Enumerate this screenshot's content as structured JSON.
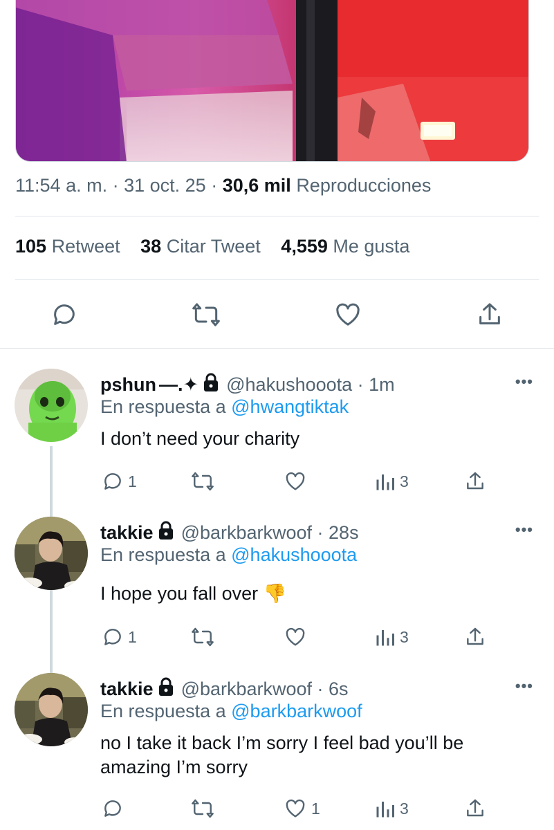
{
  "tweet": {
    "time": "11:54 a. m.",
    "sep1": "·",
    "date": "31 oct. 25",
    "sep2": "·",
    "views_count": "30,6 mil",
    "views_label": "Reproducciones",
    "retweets_count": "105",
    "retweets_label": "Retweet",
    "quotes_count": "38",
    "quotes_label": "Citar Tweet",
    "likes_count": "4,559",
    "likes_label": "Me gusta"
  },
  "replies": [
    {
      "name": "pshun",
      "name_extra": "—.✦",
      "handle_time": "@hakushooota · 1m",
      "reply_prefix": "En respuesta a",
      "reply_to": "@hwangtiktak",
      "text": "I don’t need your charity",
      "reply_count": "1",
      "retweet_count": "",
      "like_count": "",
      "views_count": "3",
      "more": "•••"
    },
    {
      "name": "takkie",
      "name_extra": "",
      "handle_time": "@barkbarkwoof · 28s",
      "reply_prefix": "En respuesta a",
      "reply_to": "@hakushooota",
      "text": "I hope you fall over 👎",
      "reply_count": "1",
      "retweet_count": "",
      "like_count": "",
      "views_count": "3",
      "more": "•••"
    },
    {
      "name": "takkie",
      "name_extra": "",
      "handle_time": "@barkbarkwoof · 6s",
      "reply_prefix": "En respuesta a",
      "reply_to": "@barkbarkwoof",
      "text": "no I take it back I’m sorry I feel bad you’ll be amazing I’m sorry",
      "reply_count": "",
      "retweet_count": "",
      "like_count": "1",
      "views_count": "3",
      "more": "•••"
    }
  ],
  "colors": {
    "accent": "#1d9bf0",
    "muted": "#536471",
    "text": "#0f1419",
    "divider": "#e1e6ea"
  },
  "icons": [
    "reply-icon",
    "retweet-icon",
    "like-icon",
    "share-icon",
    "views-icon",
    "lock-icon",
    "more-icon"
  ]
}
